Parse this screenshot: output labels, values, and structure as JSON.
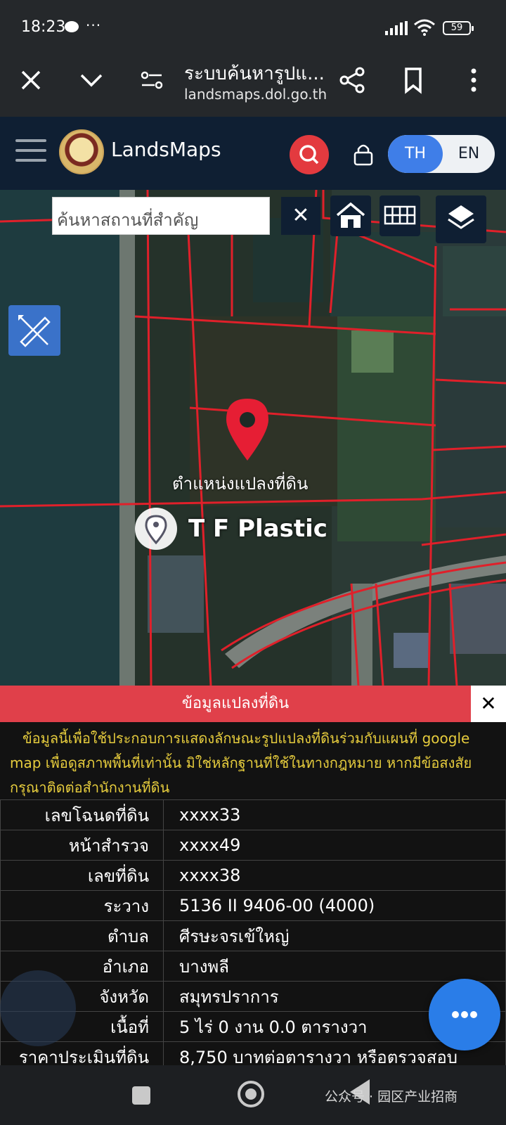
{
  "status_bar": {
    "time": "18:23",
    "more": "···",
    "battery": "59"
  },
  "browser": {
    "title": "ระบบค้นหารูปแ...",
    "url": "landsmaps.dol.go.th",
    "icons": [
      "close-icon",
      "chevron-down-icon",
      "site-settings-icon",
      "share-icon",
      "bookmark-icon",
      "more-vert-icon"
    ]
  },
  "app": {
    "brand": "LandsMaps",
    "lang_th": "TH",
    "lang_en": "EN",
    "colors": {
      "header": "#0f1f33",
      "accent_red": "#e33a3f",
      "lang_active": "#3f7ee8",
      "disclaimer": "#e6cc3d"
    }
  },
  "map": {
    "search_placeholder": "ค้นหาสถานที่สำคัญ",
    "clear": "✕",
    "pin_label": "ตำแหน่งแปลงที่ดิน",
    "place_label": "T F Plastic"
  },
  "panel": {
    "title": "ข้อมูลแปลงที่ดิน",
    "close": "✕",
    "disclaimer": "ข้อมูลนี้เพื่อใช้ประกอบการแสดงลักษณะรูปแปลงที่ดินร่วมกับแผนที่ google map เพื่อดูสภาพพื้นที่เท่านั้น มิใช่หลักฐานที่ใช้ในทางกฎหมาย หากมีข้อสงสัย กรุณาติดต่อสำนักงานที่ดิน",
    "rows": [
      {
        "label": "เลขโฉนดที่ดิน",
        "value": "xxxx33"
      },
      {
        "label": "หน้าสำรวจ",
        "value": "xxxx49"
      },
      {
        "label": "เลขที่ดิน",
        "value": "xxxx38"
      },
      {
        "label": "ระวาง",
        "value": "5136 II 9406-00 (4000)"
      },
      {
        "label": "ตำบล",
        "value": "ศีรษะจรเข้ใหญ่"
      },
      {
        "label": "อำเภอ",
        "value": "บางพลี"
      },
      {
        "label": "จังหวัด",
        "value": "สมุทรปราการ"
      },
      {
        "label": "เนื้อที่",
        "value": "5 ไร่ 0 งาน 0.0 ตารางวา"
      },
      {
        "label": "ราคาประเมินที่ดิน",
        "value": "8,750 บาทต่อตารางวา หรือตรวจสอบ"
      }
    ]
  },
  "watermark": "公众号 · 园区产业招商"
}
